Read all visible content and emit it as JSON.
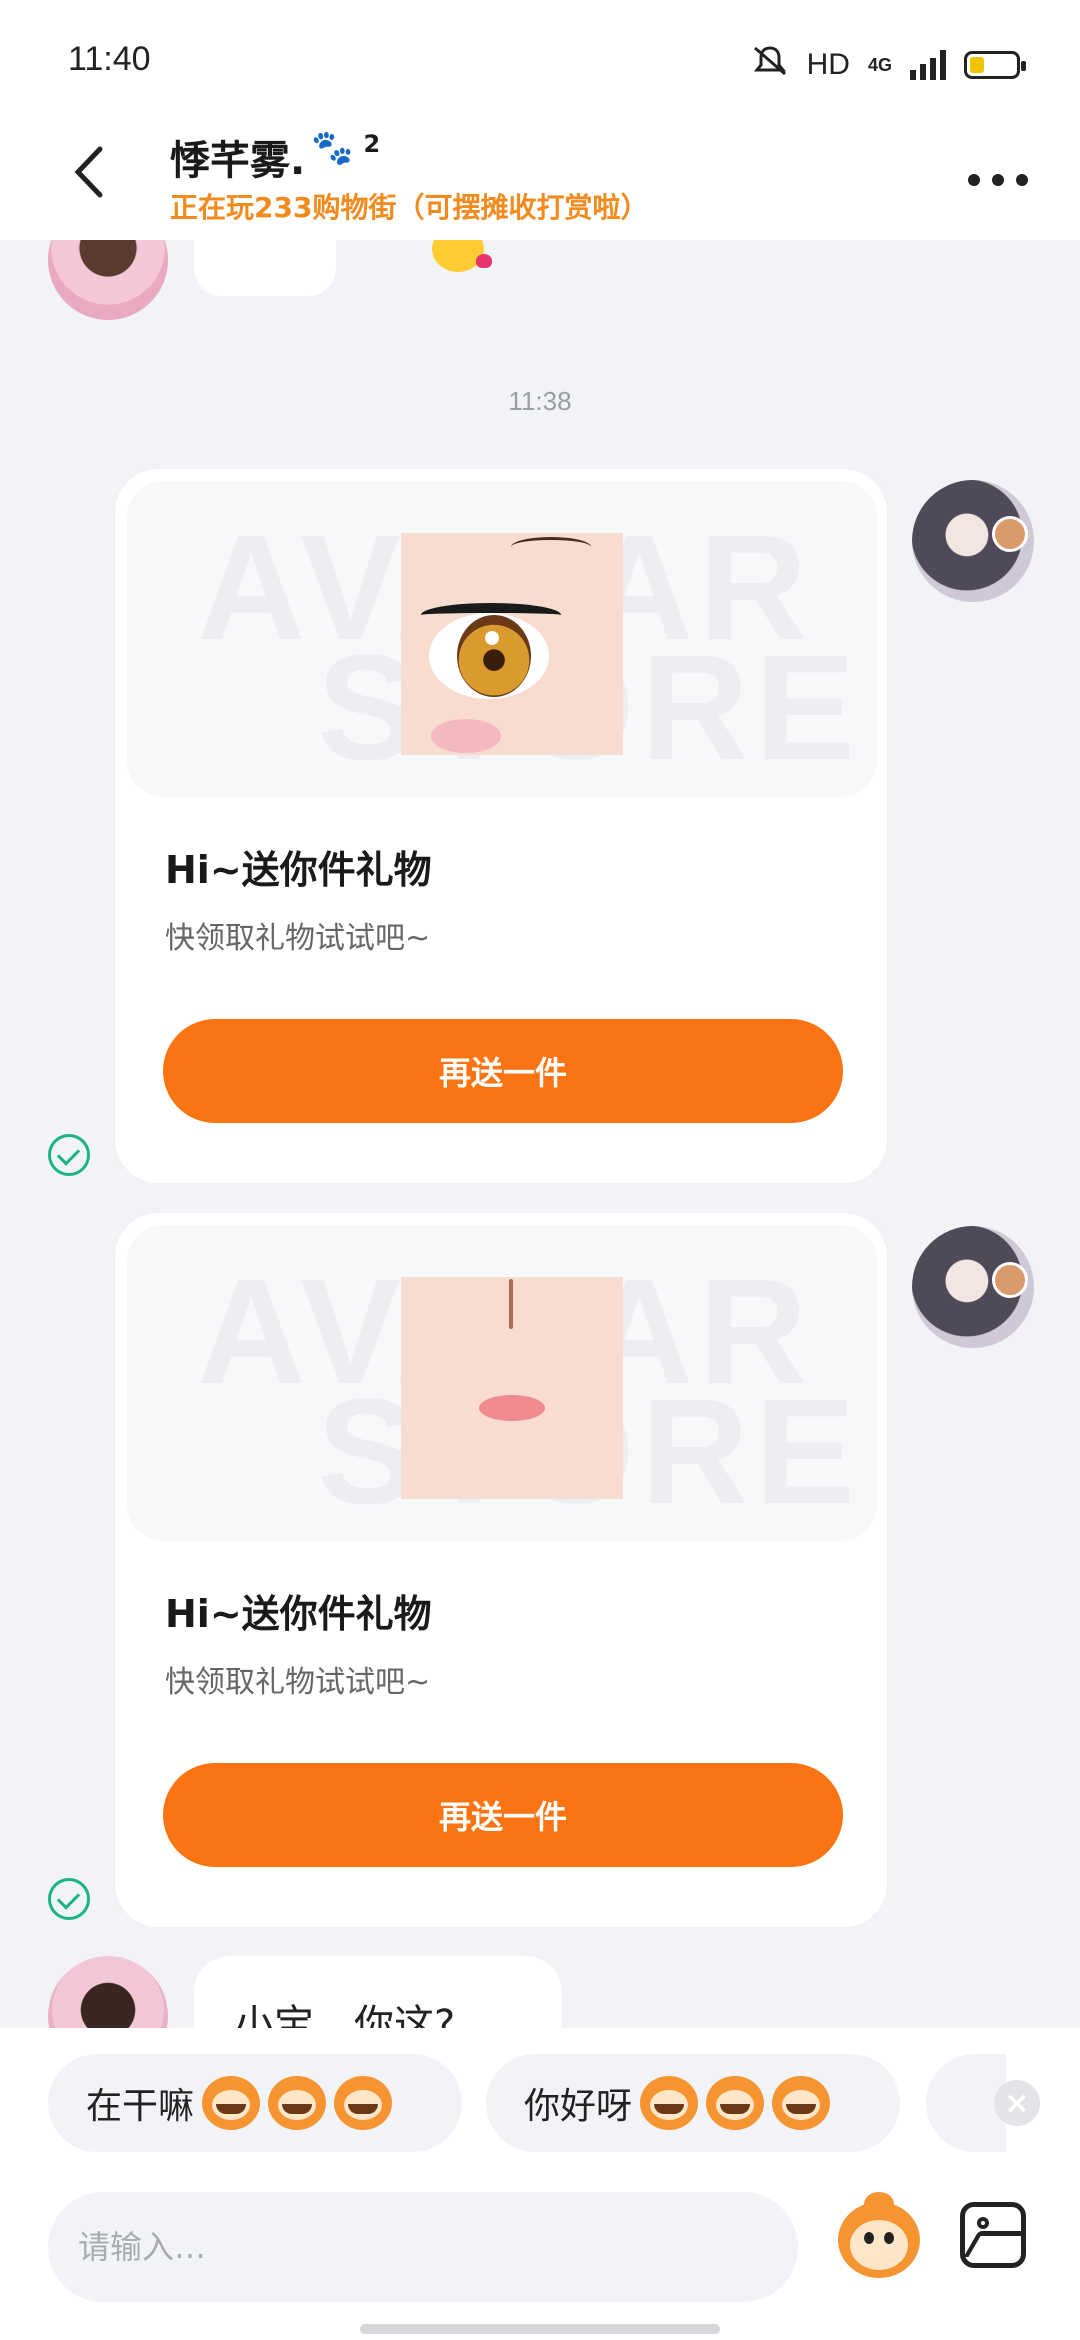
{
  "status_bar": {
    "time": "11:40",
    "hd": "HD",
    "network": "4G",
    "battery_level": 0.28,
    "battery_color": "#f2c300"
  },
  "header": {
    "contact_name": "悸芊雾.",
    "name_badge": "2",
    "status": "正在玩233购物街（可摆摊收打赏啦）",
    "status_color": "#f28a1e",
    "back_icon": "chevron-left-icon",
    "more_icon": "more-dots-icon"
  },
  "chat": {
    "timestamp": "11:38",
    "messages": [
      {
        "title": "Hi~送你件礼物",
        "subtitle": "快领取礼物试试吧~",
        "button_label": "再送一件",
        "watermark_top": "AVATAR",
        "watermark_bottom": "STORE",
        "image": "anime-eye-thumbnail",
        "status_icon": "check-circle-icon"
      },
      {
        "title": "Hi~送你件礼物",
        "subtitle": "快领取礼物试试吧~",
        "button_label": "再送一件",
        "watermark_top": "AVATAR",
        "watermark_bottom": "STORE",
        "image": "anime-lips-thumbnail",
        "status_icon": "check-circle-icon"
      }
    ],
    "incoming_text": "小宝，你这?"
  },
  "quick_replies": [
    {
      "label": "在干嘛",
      "icon": "monkey-grin-icon"
    },
    {
      "label": "你好呀",
      "icon": "monkey-wow-icon"
    }
  ],
  "input": {
    "placeholder": "请输入…"
  },
  "accent_color": "#fb7413",
  "sent_check_color": "#1ab385"
}
